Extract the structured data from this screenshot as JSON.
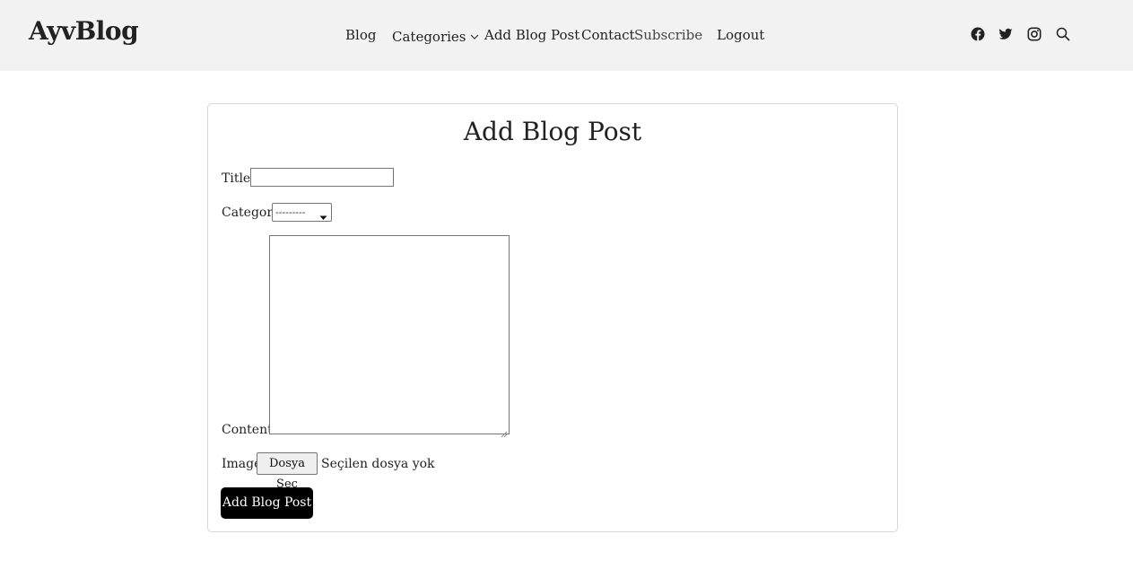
{
  "header": {
    "logo": "AyvBlog",
    "nav": [
      {
        "label": "Blog"
      },
      {
        "label": "Categories"
      },
      {
        "label": "Add Blog Post"
      },
      {
        "label": "Contact"
      },
      {
        "label": "Subscribe"
      },
      {
        "label": "Logout"
      }
    ],
    "icons": [
      "facebook-icon",
      "twitter-icon",
      "instagram-icon",
      "search-icon"
    ]
  },
  "form": {
    "heading": "Add Blog Post",
    "title_label": "Title:",
    "title_value": "",
    "category_label": "Category:",
    "category_selected": "---------",
    "content_label": "Content:",
    "content_value": "",
    "image_label": "Image:",
    "file_button": "Dosya Seç",
    "file_status": "Seçilen dosya yok",
    "submit_label": "Add Blog Post"
  },
  "colors": {
    "header_bg": "#f2f2f2",
    "submit_bg": "#000000",
    "card_border": "#d6d6d6"
  }
}
